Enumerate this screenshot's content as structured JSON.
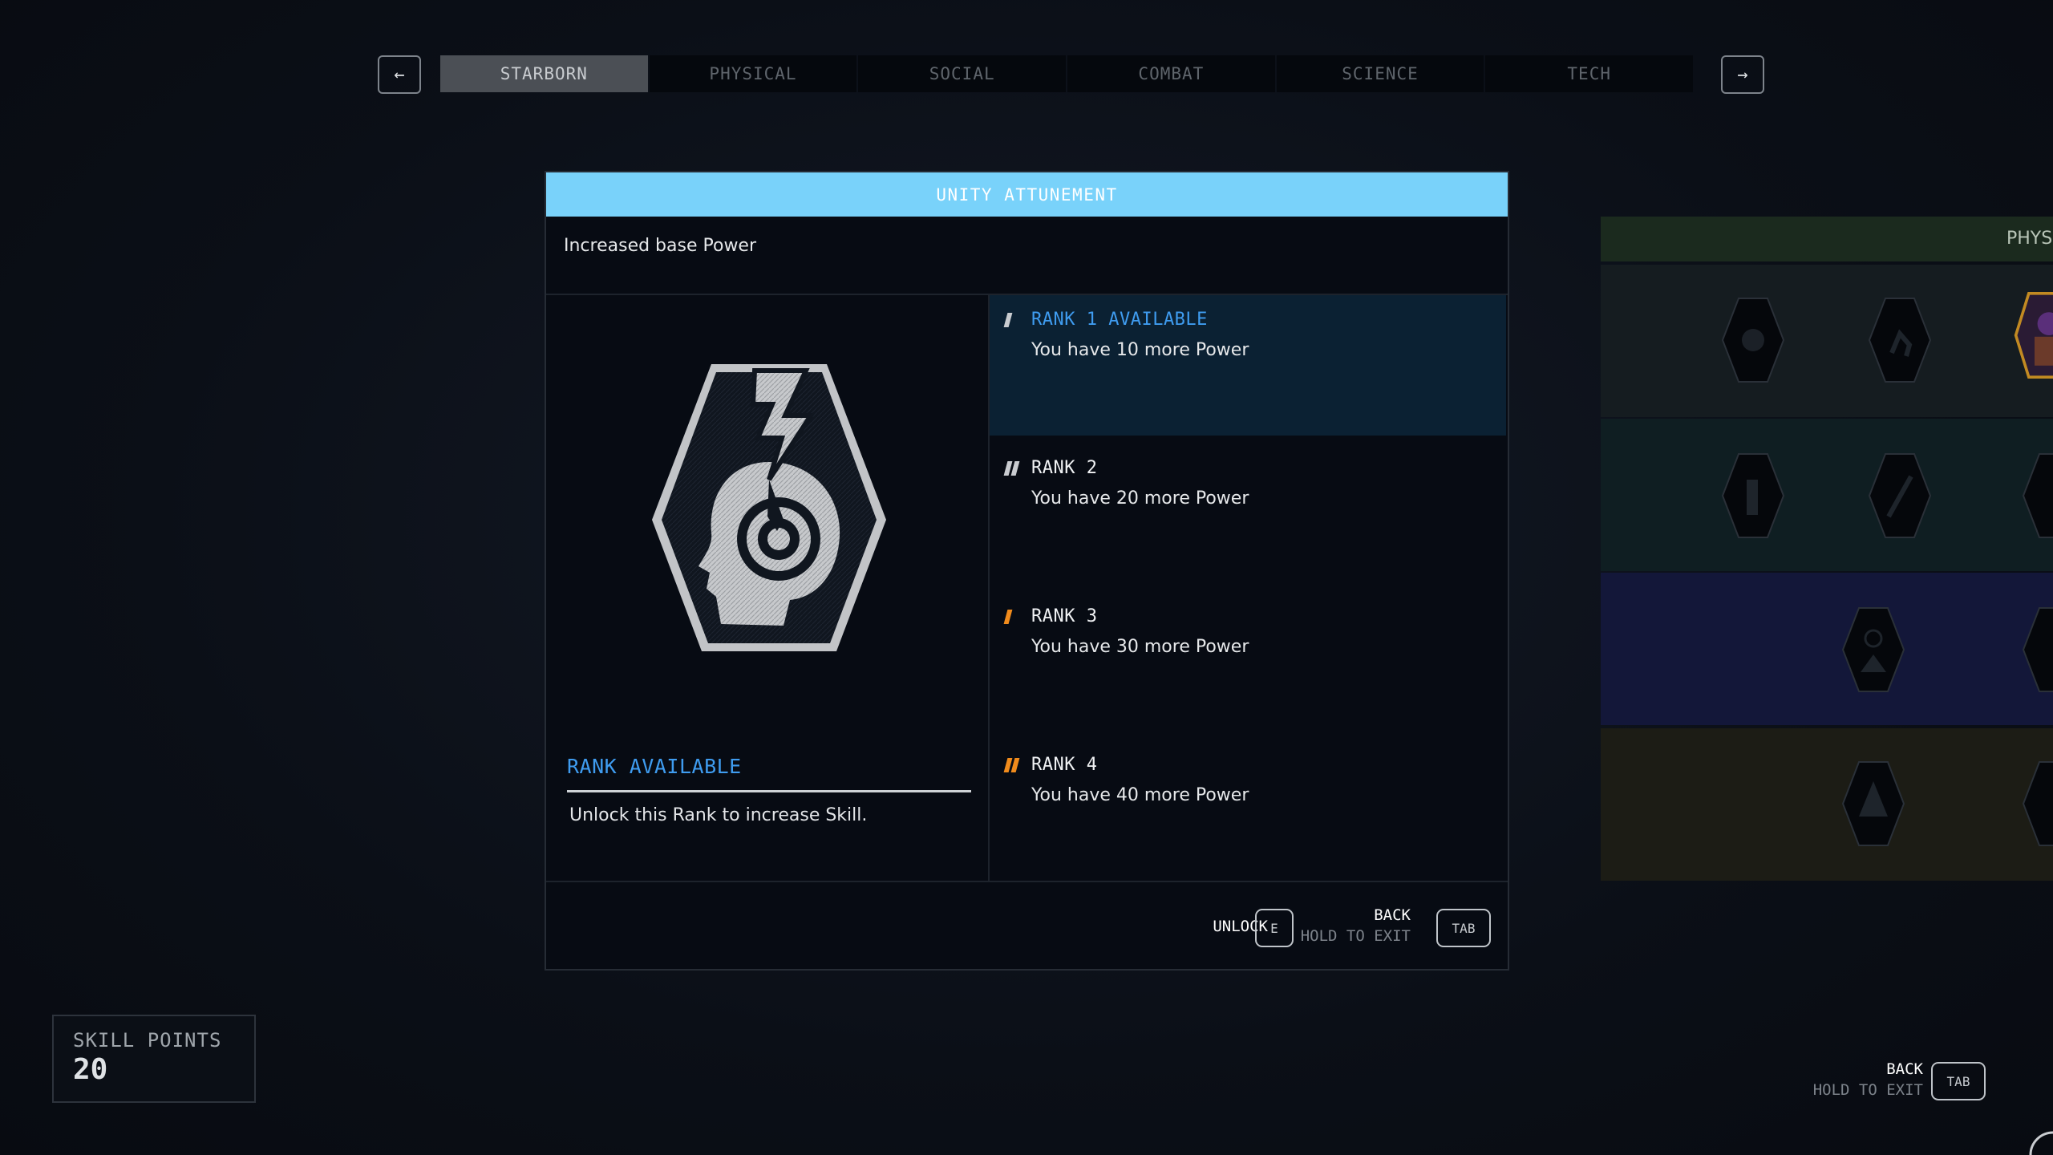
{
  "nav": {
    "prev_icon": "arrow-left-icon",
    "next_icon": "arrow-right-icon",
    "prev_glyph": "←",
    "next_glyph": "→",
    "tabs": [
      {
        "label": "STARBORN",
        "active": true
      },
      {
        "label": "PHYSICAL",
        "active": false
      },
      {
        "label": "SOCIAL",
        "active": false
      },
      {
        "label": "COMBAT",
        "active": false
      },
      {
        "label": "SCIENCE",
        "active": false
      },
      {
        "label": "TECH",
        "active": false
      }
    ]
  },
  "skill": {
    "title": "UNITY ATTUNEMENT",
    "description": "Increased base Power",
    "badge_icon": "lightning-head-badge-icon",
    "status": "RANK AVAILABLE",
    "status_hint": "Unlock this Rank to increase Skill."
  },
  "ranks": [
    {
      "title": "RANK 1 AVAILABLE",
      "text": "You have 10 more Power",
      "marker_color": "#c9ccd0",
      "marker_count": 1
    },
    {
      "title": "RANK 2",
      "text": "You have 20 more Power",
      "marker_color": "#c9ccd0",
      "marker_count": 2
    },
    {
      "title": "RANK 3",
      "text": "You have 30 more Power",
      "marker_color": "#f08b1c",
      "marker_count": 1
    },
    {
      "title": "RANK 4",
      "text": "You have 40 more Power",
      "marker_color": "#f08b1c",
      "marker_count": 2
    }
  ],
  "footer": {
    "unlock_label": "UNLOCK",
    "unlock_key": "E",
    "back_label": "BACK",
    "hold_label": "HOLD TO EXIT",
    "back_key": "TAB"
  },
  "tree": {
    "header_label": "PHYS",
    "row_colors": [
      "#151c20",
      "#0f1e22",
      "#131739",
      "#1c1c15"
    ]
  },
  "skill_points": {
    "label": "SKILL POINTS",
    "value": "20"
  },
  "global_footer": {
    "back_label": "BACK",
    "hold_label": "HOLD TO EXIT",
    "back_key": "TAB"
  },
  "colors": {
    "accent": "#79d2fa",
    "available": "#3f9cf0",
    "orange": "#f08b1c"
  }
}
